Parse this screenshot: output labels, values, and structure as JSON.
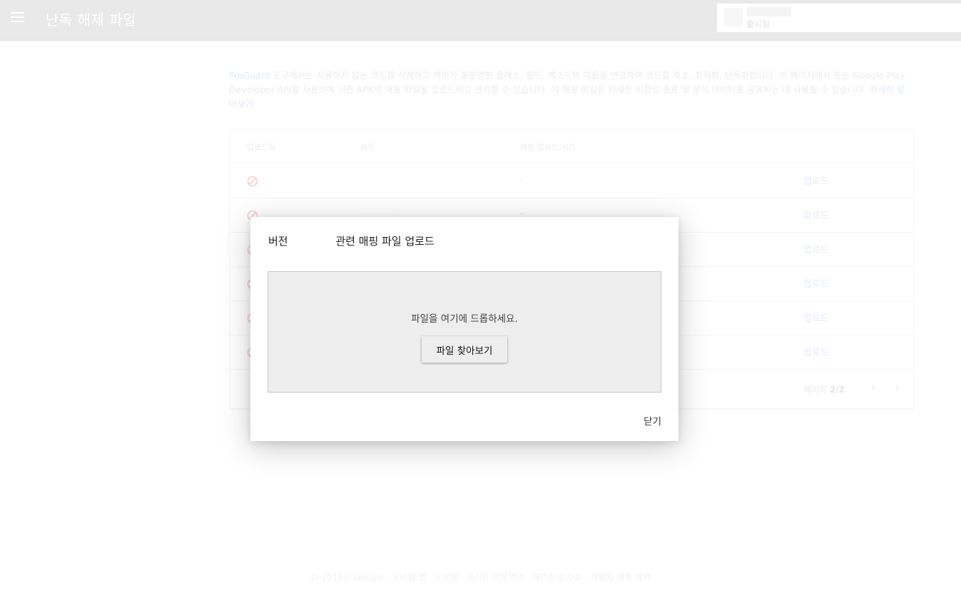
{
  "topbar": {
    "title": "난독 해제 파일",
    "app_status": "출시됨"
  },
  "intro": {
    "link_proguard": "ProGuard",
    "text": " 도구에서는 사용하지 않는 코드를 삭제하고 의미가 불분명한 클래스, 필드, 메소드의 이름을 변경하여 코드를 축소, 최적화, 난독화합니다. 이 페이지에서 또는 Google Play Developer API를 사용하여 기존 APK의 매핑 파일을 업로드하고 관리할 수 있습니다. 이 매핑 파일은 자세한 비정상 종료 및 분석 데이터를 공유하는 데 사용될 수 있습니다. ",
    "link_learn_more": "자세히 알아보기"
  },
  "table": {
    "headers": {
      "uploaded": "업로드됨",
      "version": "버전",
      "upload_time": "매핑 업로드 시간"
    },
    "rows": [
      {
        "time": "–",
        "action": "업로드"
      },
      {
        "time": "–",
        "action": "업로드"
      },
      {
        "time": "",
        "action": "업로드"
      },
      {
        "time": "",
        "action": "업로드"
      },
      {
        "time": "",
        "action": "업로드"
      },
      {
        "time": "",
        "action": "업로드"
      }
    ],
    "pager": {
      "label": "페이지",
      "value": "2/2"
    }
  },
  "footer": "© 2019년 Google · 모바일 앱 · 도움말 · 사이트 이용약관 · 개인정보 보호 · 개발자 배포 계약",
  "dialog": {
    "title": "버전              관련 매핑 파일 업로드",
    "drop_text": "파일을 여기에 드롭하세요.",
    "browse_label": "파일 찾아보기",
    "close_label": "닫기"
  },
  "colors": {
    "accent": "#4285f4",
    "blocked": "#d50000",
    "scrim": "#ffffff"
  }
}
